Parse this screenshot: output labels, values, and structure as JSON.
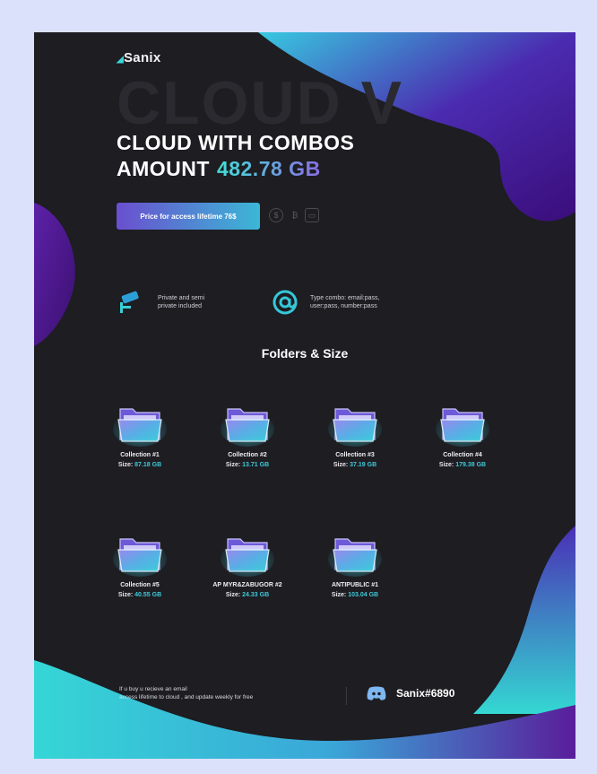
{
  "brand": {
    "name": "Sanix"
  },
  "hero": {
    "ghost_text": "CLOUD V",
    "heading_line1": "CLOUD WITH COMBOS",
    "heading_line2": "AMOUNT",
    "amount": "482.78 GB"
  },
  "price_button": {
    "label": "Price for access lifetime 76$"
  },
  "payment_icons": [
    "dollar-coin-icon",
    "bitcoin-icon",
    "wallet-icon"
  ],
  "features": [
    {
      "icon": "camera-icon",
      "text_line1": "Private and semi",
      "text_line2": "private included"
    },
    {
      "icon": "at-sign-icon",
      "text_line1": "Type combo: email:pass,",
      "text_line2": "user:pass, number:pass"
    }
  ],
  "folders_section": {
    "title": "Folders & Size"
  },
  "folders": [
    {
      "name": "Collection #1",
      "size_label": "Size:",
      "size": "87.18 GB"
    },
    {
      "name": "Collection #2",
      "size_label": "Size:",
      "size": "13.71 GB"
    },
    {
      "name": "Collection #3",
      "size_label": "Size:",
      "size": "37.19 GB"
    },
    {
      "name": "Collection #4",
      "size_label": "Size:",
      "size": "179.38 GB"
    },
    {
      "name": "Collection #5",
      "size_label": "Size:",
      "size": "40.55 GB"
    },
    {
      "name": "AP MYR&ZABUGOR #2",
      "size_label": "Size:",
      "size": "24.33 GB"
    },
    {
      "name": "ANTIPUBLIC #1",
      "size_label": "Size:",
      "size": "103.04 GB"
    }
  ],
  "footer": {
    "text_line1": "If u buy u recieve an email",
    "text_line2": "access lifetime to cloud , and update weekly for free",
    "discord_handle": "Sanix#6890"
  },
  "colors": {
    "page_bg": "#dbe0fb",
    "poster_bg": "#1d1d22",
    "accent_cyan": "#38d7d9",
    "accent_purple": "#5a1d9a"
  }
}
